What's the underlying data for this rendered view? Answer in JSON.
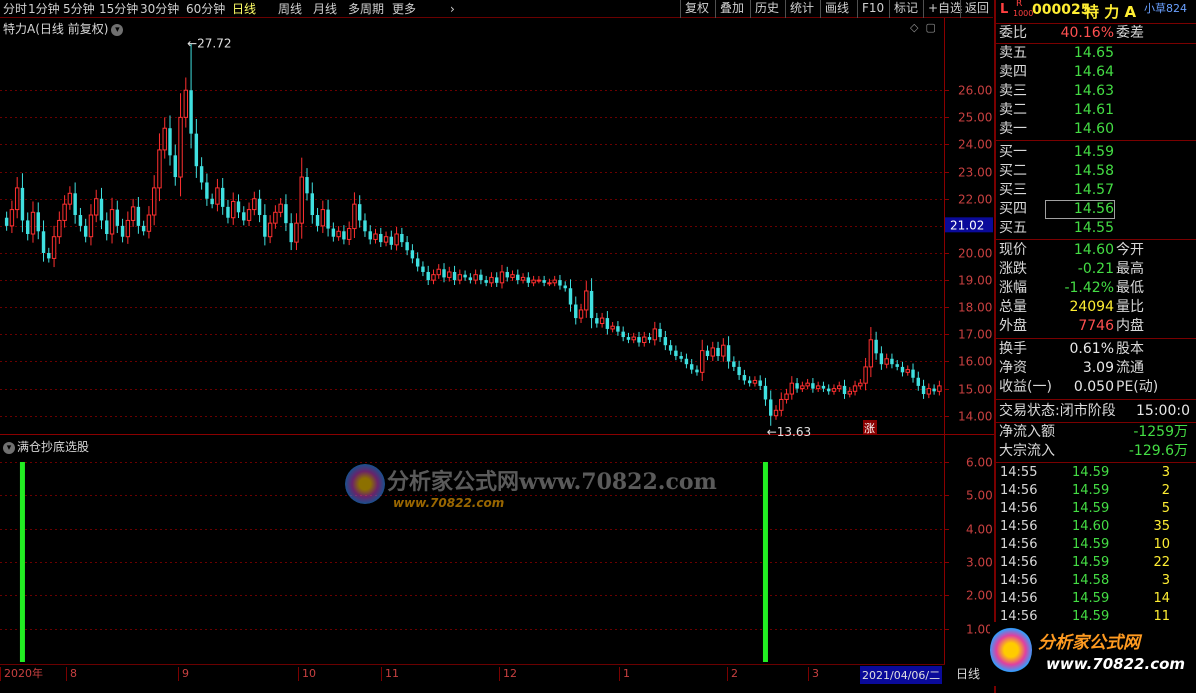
{
  "toolbar": {
    "periods": [
      "分时",
      "1分钟",
      "5分钟",
      "15分钟",
      "30分钟",
      "60分钟",
      "日线",
      "周线",
      "月线",
      "多周期",
      "更多"
    ],
    "active_period": "日线",
    "tools": [
      "复权",
      "叠加",
      "历史",
      "统计",
      "画线",
      "F10",
      "标记",
      "+自选",
      "返回"
    ]
  },
  "main": {
    "title": "特力A(日线 前复权)",
    "current_price_label": "21.02",
    "high_annotation": "27.72",
    "low_annotation": "13.63",
    "zhang_badge": "涨"
  },
  "indicator": {
    "title": "满仓抄底选股",
    "watermark_cn": "分析家公式网www.70822.com",
    "watermark_url": "www.70822.com"
  },
  "datebar": {
    "months": [
      "2020年",
      "8",
      "9",
      "10",
      "11",
      "12",
      "1",
      "2",
      "3"
    ],
    "current_date": "2021/04/06/二",
    "period": "日线"
  },
  "quote": {
    "market_badge_l": "L",
    "market_badge_r": "R",
    "market_badge_num": "1000",
    "code": "000025",
    "name": "特 力 A",
    "tag": "小草824",
    "webi_label": "委比",
    "webi_value": "40.16%",
    "weicha_label": "委差",
    "asks": [
      {
        "label": "卖五",
        "price": "14.65"
      },
      {
        "label": "卖四",
        "price": "14.64"
      },
      {
        "label": "卖三",
        "price": "14.63"
      },
      {
        "label": "卖二",
        "price": "14.61"
      },
      {
        "label": "卖一",
        "price": "14.60"
      }
    ],
    "bids": [
      {
        "label": "买一",
        "price": "14.59"
      },
      {
        "label": "买二",
        "price": "14.58"
      },
      {
        "label": "买三",
        "price": "14.57"
      },
      {
        "label": "买四",
        "price": "14.56"
      },
      {
        "label": "买五",
        "price": "14.55"
      }
    ],
    "stats": [
      {
        "label": "现价",
        "value": "14.60",
        "color": "green",
        "label2": "今开"
      },
      {
        "label": "涨跌",
        "value": "-0.21",
        "color": "green",
        "label2": "最高"
      },
      {
        "label": "涨幅",
        "value": "-1.42%",
        "color": "green",
        "label2": "最低"
      },
      {
        "label": "总量",
        "value": "24094",
        "color": "yellow",
        "label2": "量比"
      },
      {
        "label": "外盘",
        "value": "7746",
        "color": "red",
        "label2": "内盘"
      }
    ],
    "fund": [
      {
        "label": "换手",
        "value": "0.61%",
        "label2": "股本"
      },
      {
        "label": "净资",
        "value": "3.09",
        "label2": "流通"
      },
      {
        "label": "收益(一)",
        "value": "0.050",
        "label2": "PE(动)"
      }
    ],
    "trade_status": "交易状态:闭市阶段",
    "trade_time": "15:00:0",
    "net_inflow_label": "净流入额",
    "net_inflow_value": "-1259万",
    "block_inflow_label": "大宗流入",
    "block_inflow_value": "-129.6万",
    "ticks": [
      {
        "time": "14:55",
        "price": "14.59",
        "vol": "3"
      },
      {
        "time": "14:56",
        "price": "14.59",
        "vol": "2"
      },
      {
        "time": "14:56",
        "price": "14.59",
        "vol": "5"
      },
      {
        "time": "14:56",
        "price": "14.60",
        "vol": "35"
      },
      {
        "time": "14:56",
        "price": "14.59",
        "vol": "10"
      },
      {
        "time": "14:56",
        "price": "14.59",
        "vol": "22"
      },
      {
        "time": "14:56",
        "price": "14.58",
        "vol": "3"
      },
      {
        "time": "14:56",
        "price": "14.59",
        "vol": "14"
      },
      {
        "time": "14:56",
        "price": "14.59",
        "vol": "11"
      }
    ],
    "logo_text": "分析家公式网",
    "logo_url": "www.70822.com"
  },
  "chart_data": [
    {
      "type": "candlestick",
      "y_ticks": [
        "26.00",
        "25.00",
        "24.00",
        "23.00",
        "22.00",
        "21.00",
        "20.00",
        "19.00",
        "18.00",
        "17.00",
        "16.00",
        "15.00",
        "14.00"
      ],
      "ylim": [
        13.4,
        28.0
      ],
      "colors": {
        "up": "#ff3030",
        "down": "#40e0e0"
      },
      "closes": [
        21.0,
        21.6,
        22.4,
        21.2,
        20.7,
        21.5,
        20.8,
        20.0,
        19.8,
        20.6,
        21.2,
        21.8,
        22.2,
        21.4,
        21.0,
        20.6,
        21.4,
        22.0,
        21.2,
        20.7,
        21.6,
        21.0,
        20.6,
        21.2,
        21.7,
        21.0,
        20.8,
        21.4,
        22.4,
        23.8,
        24.6,
        23.6,
        22.8,
        25.0,
        26.0,
        24.4,
        23.2,
        22.6,
        22.0,
        21.8,
        22.4,
        21.7,
        21.3,
        21.9,
        21.5,
        21.2,
        21.6,
        22.0,
        21.4,
        20.6,
        21.1,
        21.5,
        21.8,
        21.1,
        20.4,
        21.1,
        22.8,
        22.2,
        21.4,
        21.0,
        21.6,
        20.9,
        20.6,
        20.8,
        20.5,
        20.9,
        21.8,
        21.2,
        20.8,
        20.5,
        20.7,
        20.4,
        20.6,
        20.3,
        20.7,
        20.4,
        20.1,
        19.8,
        19.5,
        19.3,
        19.0,
        19.2,
        19.4,
        19.1,
        19.3,
        19.0,
        19.2,
        19.1,
        19.0,
        19.2,
        19.0,
        18.9,
        19.1,
        18.9,
        19.3,
        19.1,
        19.2,
        19.0,
        19.1,
        18.9,
        19.0,
        19.0,
        18.9,
        18.9,
        19.0,
        18.8,
        18.7,
        18.1,
        17.6,
        17.9,
        18.6,
        17.6,
        17.4,
        17.6,
        17.2,
        17.3,
        17.1,
        16.9,
        16.8,
        16.9,
        16.7,
        16.9,
        16.8,
        17.2,
        16.9,
        16.6,
        16.4,
        16.2,
        16.1,
        15.9,
        15.7,
        15.6,
        16.4,
        16.2,
        16.5,
        16.2,
        16.6,
        16.0,
        15.8,
        15.5,
        15.3,
        15.2,
        15.3,
        15.1,
        14.6,
        14.0,
        14.2,
        14.6,
        14.8,
        15.2,
        15.0,
        15.1,
        15.2,
        15.0,
        15.1,
        15.0,
        14.9,
        15.0,
        15.1,
        14.8,
        14.9,
        15.1,
        15.2,
        15.8,
        16.8,
        16.3,
        15.9,
        16.1,
        15.9,
        15.8,
        15.6,
        15.7,
        15.4,
        15.1,
        14.8,
        15.0,
        14.9,
        15.1
      ],
      "annotations": [
        "27.72",
        "13.63"
      ]
    },
    {
      "type": "bar",
      "title": "满仓抄底选股",
      "y_ticks": [
        "6.00",
        "5.00",
        "4.00",
        "3.00",
        "2.00",
        "1.00"
      ],
      "ylim": [
        0,
        6.3
      ],
      "signals": [
        {
          "index": 3,
          "value": 6
        },
        {
          "index": 144,
          "value": 6
        }
      ],
      "color": "#22ee22"
    }
  ]
}
